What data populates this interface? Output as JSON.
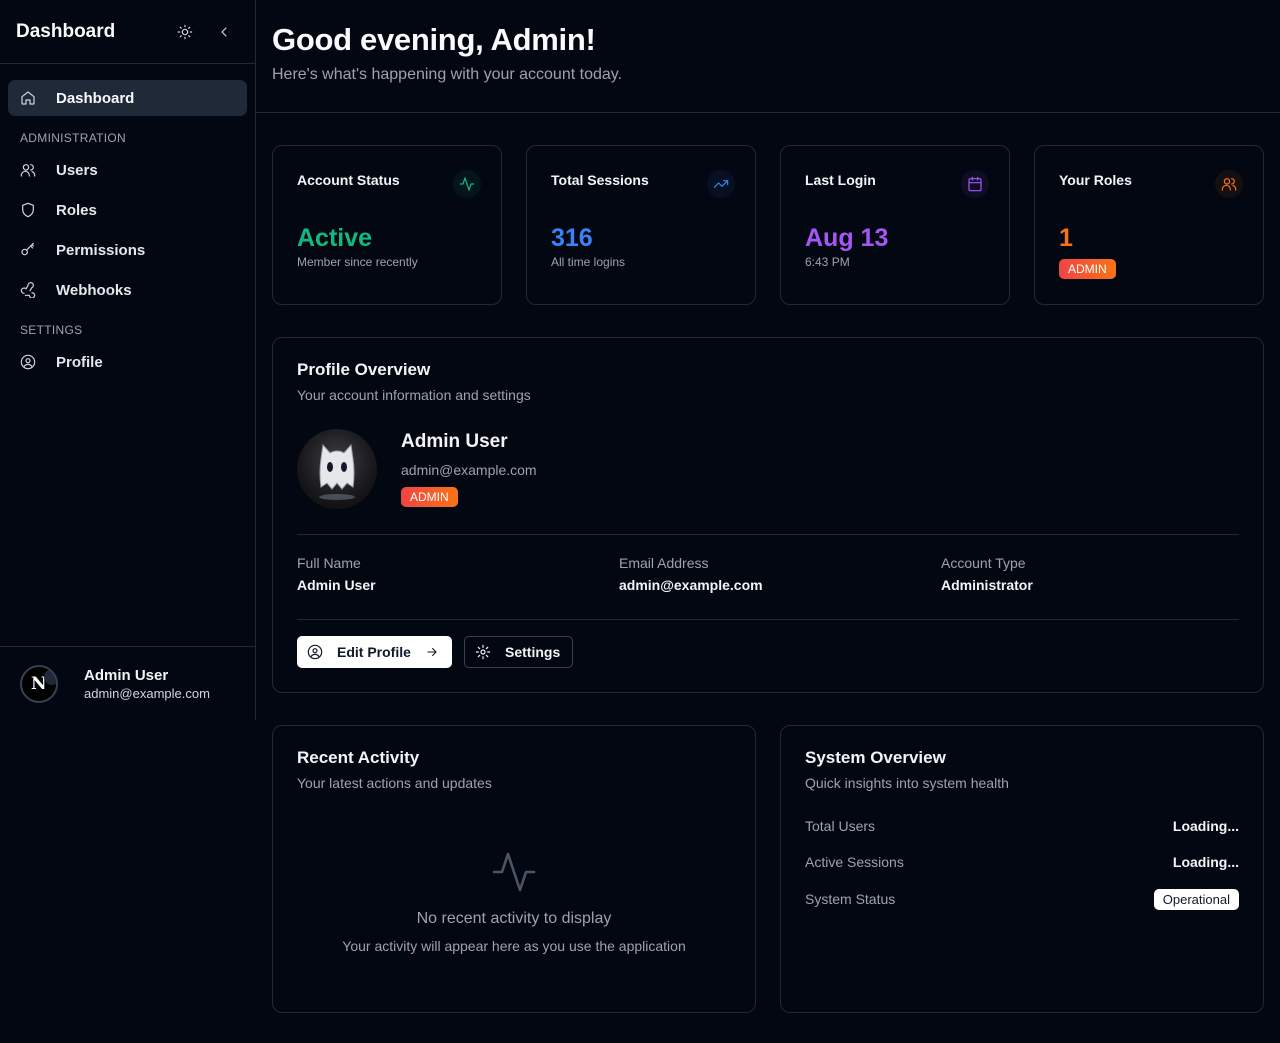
{
  "sidebar": {
    "title": "Dashboard",
    "theme_icon": "sun-icon",
    "collapse_icon": "chevron-left-icon",
    "nav": {
      "dashboard": "Dashboard",
      "section_admin": "ADMINISTRATION",
      "users": "Users",
      "roles": "Roles",
      "permissions": "Permissions",
      "webhooks": "Webhooks",
      "section_settings": "SETTINGS",
      "profile": "Profile"
    },
    "user": {
      "name": "Admin User",
      "email": "admin@example.com"
    }
  },
  "header": {
    "greeting": "Good evening, Admin!",
    "subtitle": "Here's what's happening with your account today."
  },
  "stats": {
    "account_status": {
      "label": "Account Status",
      "value": "Active",
      "sub": "Member since recently",
      "icon": "activity-icon",
      "color": "#10b981"
    },
    "total_sessions": {
      "label": "Total Sessions",
      "value": "316",
      "sub": "All time logins",
      "icon": "trending-up-icon",
      "color": "#3b82f6"
    },
    "last_login": {
      "label": "Last Login",
      "value": "Aug 13",
      "sub": "6:43 PM",
      "icon": "calendar-icon",
      "color": "#a855f7"
    },
    "your_roles": {
      "label": "Your Roles",
      "value": "1",
      "badge": "ADMIN",
      "icon": "users-icon",
      "color": "#f97316"
    }
  },
  "profile": {
    "title": "Profile Overview",
    "subtitle": "Your account information and settings",
    "name": "Admin User",
    "email": "admin@example.com",
    "badge": "ADMIN",
    "fields": {
      "full_name_label": "Full Name",
      "full_name": "Admin User",
      "email_label": "Email Address",
      "email": "admin@example.com",
      "type_label": "Account Type",
      "type": "Administrator"
    },
    "edit_button": "Edit Profile",
    "settings_button": "Settings"
  },
  "activity": {
    "title": "Recent Activity",
    "subtitle": "Your latest actions and updates",
    "empty_title": "No recent activity to display",
    "empty_sub": "Your activity will appear here as you use the application"
  },
  "system": {
    "title": "System Overview",
    "subtitle": "Quick insights into system health",
    "total_users_label": "Total Users",
    "total_users": "Loading...",
    "active_sessions_label": "Active Sessions",
    "active_sessions": "Loading...",
    "status_label": "System Status",
    "status": "Operational"
  }
}
